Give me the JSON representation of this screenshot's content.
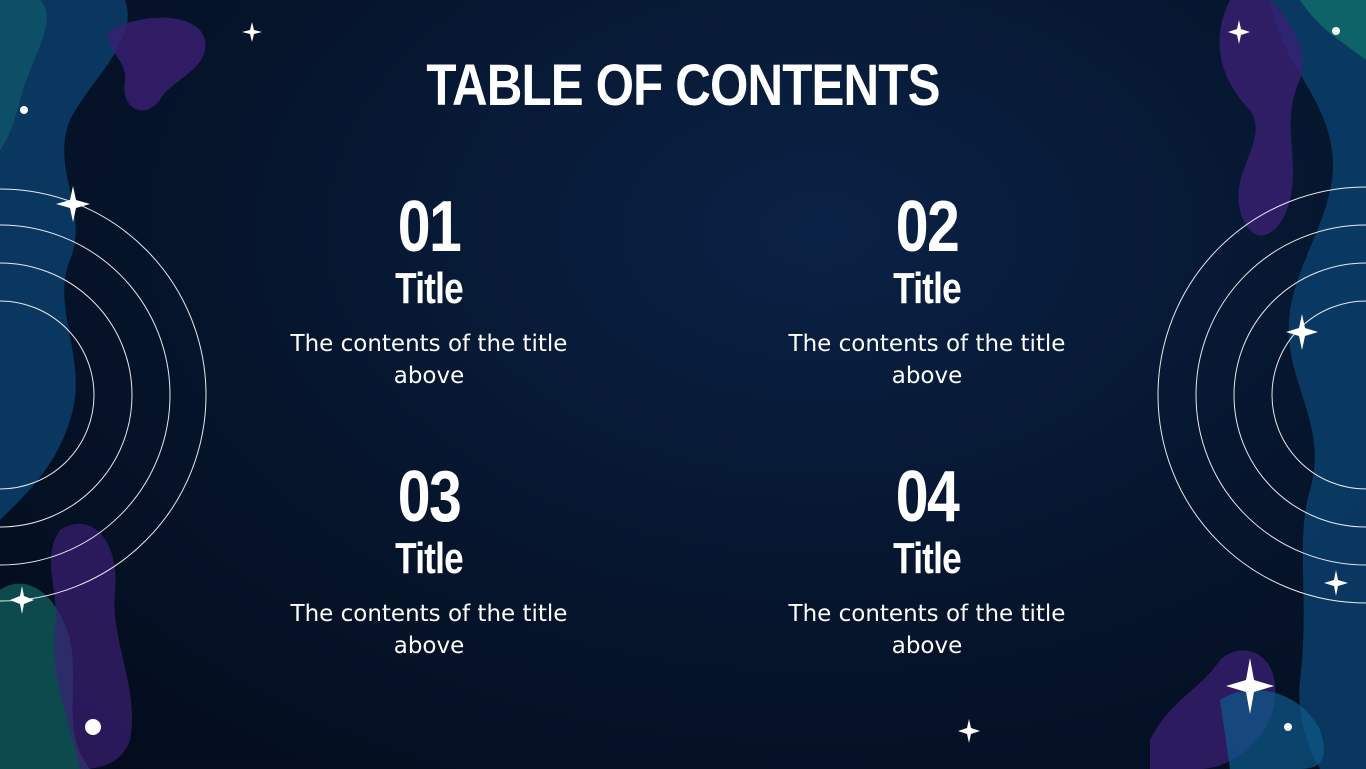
{
  "slide": {
    "heading": "TABLE OF CONTENTS",
    "items": [
      {
        "number": "01",
        "title": "Title",
        "description": "The contents of the title above"
      },
      {
        "number": "02",
        "title": "Title",
        "description": "The contents of the title above"
      },
      {
        "number": "03",
        "title": "Title",
        "description": "The contents of the title above"
      },
      {
        "number": "04",
        "title": "Title",
        "description": "The contents of the title above"
      }
    ]
  },
  "colors": {
    "background": "#06162f",
    "blob_blue": "#0b4a7a",
    "blob_purple": "#3a1f73",
    "blob_teal": "#0f6b6b",
    "text": "#ffffff"
  }
}
